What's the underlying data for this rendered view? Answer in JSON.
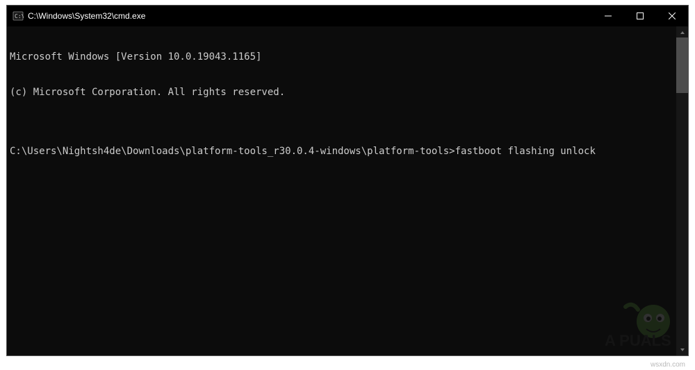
{
  "window": {
    "title": "C:\\Windows\\System32\\cmd.exe"
  },
  "terminal": {
    "lines": [
      "Microsoft Windows [Version 10.0.19043.1165]",
      "(c) Microsoft Corporation. All rights reserved.",
      "",
      ""
    ],
    "prompt": "C:\\Users\\Nightsh4de\\Downloads\\platform-tools_r30.0.4-windows\\platform-tools>",
    "command": "fastboot flashing unlock"
  },
  "footer": {
    "source_note": "wsxdn.com"
  }
}
